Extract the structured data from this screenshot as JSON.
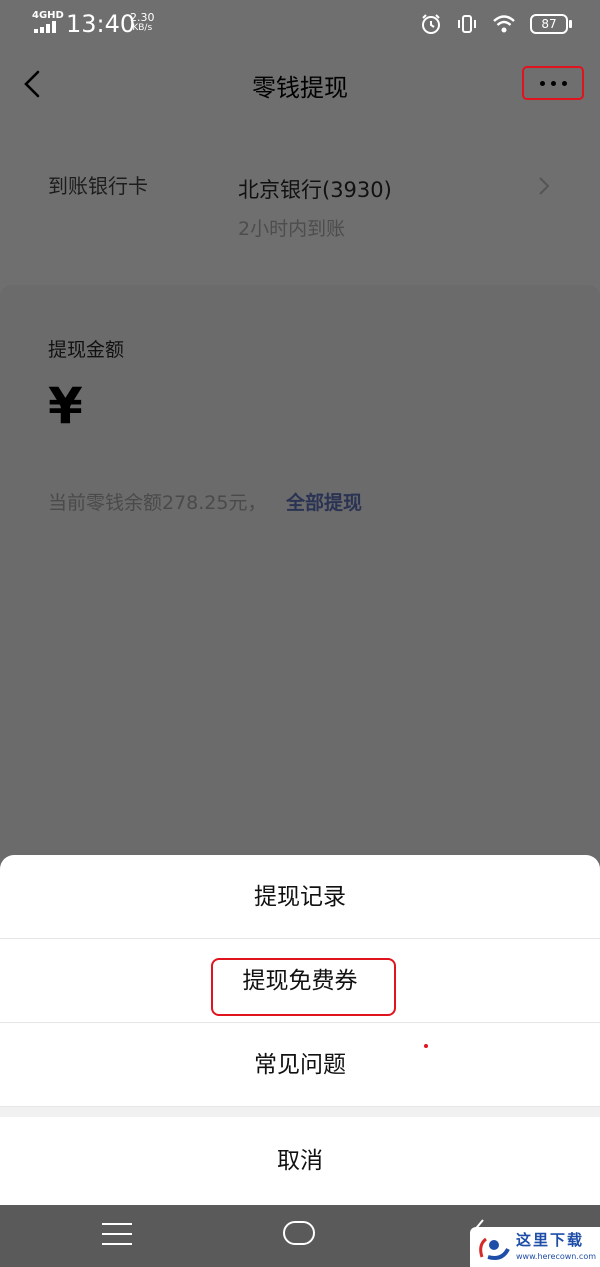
{
  "status_bar": {
    "network": "4GHD",
    "time": "13:40",
    "speed_value": "2.30",
    "speed_unit": "KB/s",
    "battery": "87"
  },
  "header": {
    "title": "零钱提现"
  },
  "bank": {
    "label": "到账银行卡",
    "name": "北京银行(3930)",
    "arrival_note": "2小时内到账"
  },
  "amount": {
    "label": "提现金额",
    "currency_symbol": "¥",
    "balance_text": "当前零钱余额278.25元，",
    "withdraw_all": "全部提现"
  },
  "action_sheet": {
    "items": [
      {
        "label": "提现记录"
      },
      {
        "label": "提现免费券"
      },
      {
        "label": "常见问题"
      }
    ],
    "cancel": "取消"
  },
  "watermark": {
    "title": "这里下载",
    "url": "www.herecown.com"
  },
  "colors": {
    "annotation_red": "#e0141e",
    "dim_overlay": "#6f6f6f",
    "link_blue": "#2a3353"
  }
}
